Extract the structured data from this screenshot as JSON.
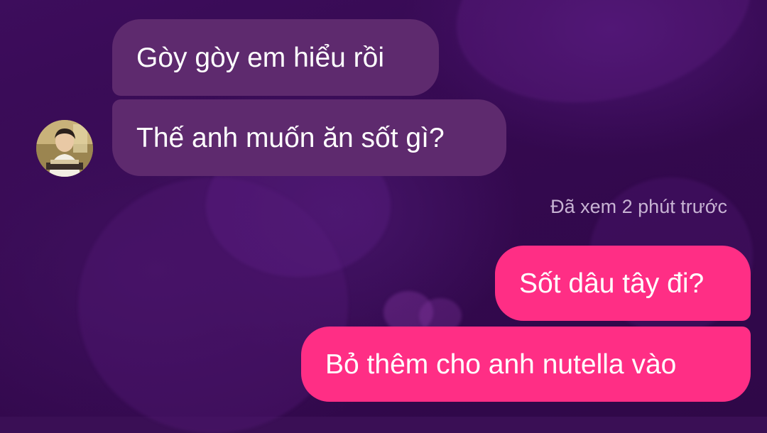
{
  "conversation": {
    "received": [
      {
        "text": "Gòy gòy em hiểu rồi"
      },
      {
        "text": "Thế anh muốn ăn sốt gì?"
      }
    ],
    "read_receipt": "Đã xem 2 phút trước",
    "sent": [
      {
        "text": "Sốt dâu tây đi?"
      },
      {
        "text": "Bỏ thêm cho anh nutella vào"
      }
    ]
  },
  "colors": {
    "received_bubble": "#5e2a6e",
    "sent_bubble": "#ff2e85",
    "background": "#3a0f55"
  },
  "contact": {
    "avatar_icon": "contact-avatar"
  }
}
